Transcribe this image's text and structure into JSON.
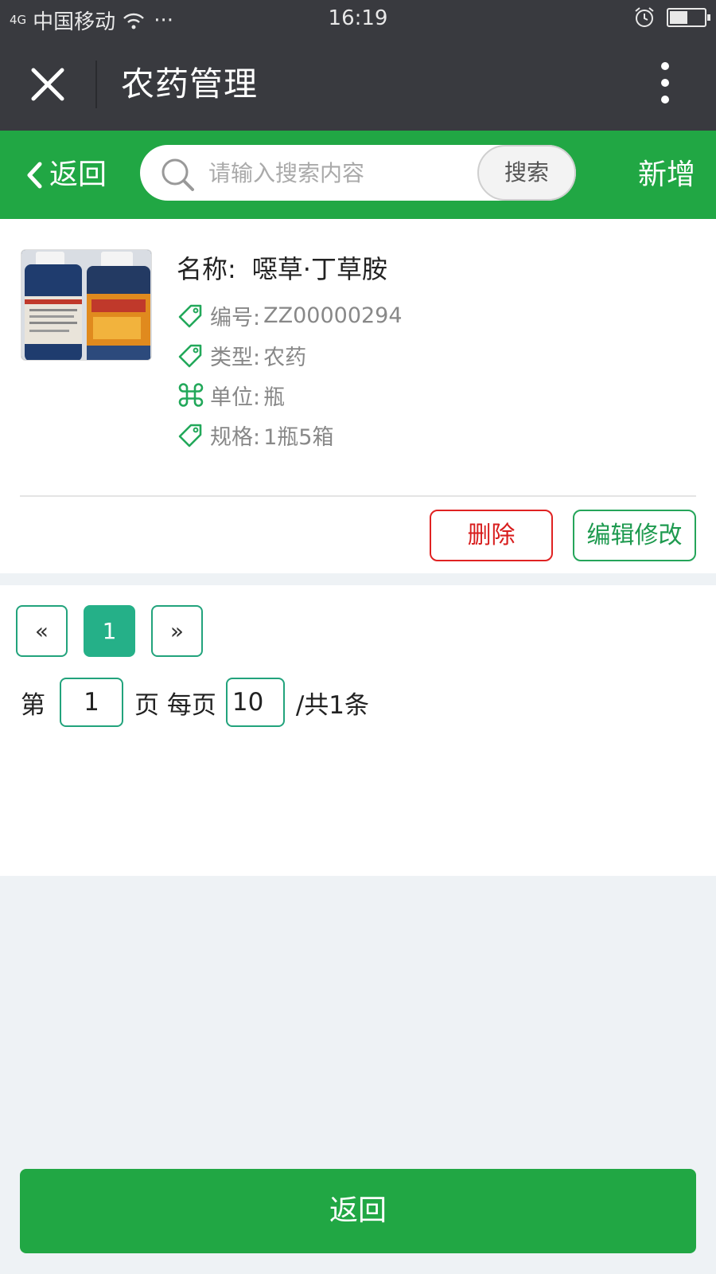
{
  "status_bar": {
    "signal": "4G",
    "carrier": "中国移动",
    "dots": "···",
    "time": "16:19"
  },
  "title_bar": {
    "title": "农药管理",
    "close_icon": "close-icon",
    "more_icon": "more-vertical-icon"
  },
  "toolbar": {
    "back_label": "返回",
    "search_placeholder": "请输入搜索内容",
    "search_value": "",
    "search_button": "搜索",
    "add_label": "新增"
  },
  "item": {
    "name_label": "名称:",
    "name": "噁草·丁草胺",
    "fields": [
      {
        "label": "编号:",
        "value": "ZZ00000294",
        "icon": "tag-icon"
      },
      {
        "label": "类型:",
        "value": "农药",
        "icon": "tag-icon"
      },
      {
        "label": "单位:",
        "value": "瓶",
        "icon": "command-icon"
      },
      {
        "label": "规格:",
        "value": "1瓶5箱",
        "icon": "tag-icon"
      }
    ],
    "delete_label": "删除",
    "edit_label": "编辑修改"
  },
  "pagination": {
    "prev": "«",
    "current_page": "1",
    "next": "»",
    "page_prefix": "第",
    "page_value": "1",
    "page_suffix": "页 每页",
    "page_size": "10",
    "total_text": "/共1条"
  },
  "footer": {
    "back_label": "返回"
  },
  "colors": {
    "header_dark": "#393a3f",
    "toolbar_green": "#21a744",
    "delete_red": "#e02222",
    "edit_green": "#25a55a",
    "pager_teal": "#25b088",
    "page_bg": "#eef2f5"
  }
}
